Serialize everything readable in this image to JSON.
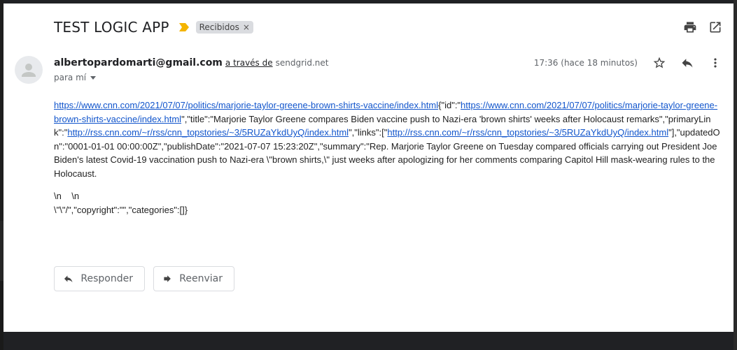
{
  "message": {
    "subject": "TEST LOGIC APP",
    "label": "Recibidos",
    "label_remove": "×",
    "sender_email": "albertopardomarti@gmail.com",
    "via_text": "a través de",
    "via_domain": "sendgrid.net",
    "to_text": "para mí",
    "time": "17:36 (hace 18 minutos)"
  },
  "body": {
    "link1": "https://www.cnn.com/2021/07/07/politics/marjorie-taylor-greene-brown-shirts-vaccine/index.html",
    "t1": "{\"id\":\"",
    "link2": "https://www.cnn.com/2021/07/07/politics/marjorie-taylor-greene-brown-shirts-vaccine/index.html",
    "t2": "\",\"title\":\"Marjorie Taylor Greene compares Biden vaccine push to Nazi-era 'brown shirts' weeks after Holocaust remarks\",\"primaryLink\":\"",
    "link3": "http://rss.cnn.com/~r/rss/cnn_topstories/~3/5RUZaYkdUyQ/index.html",
    "t3": "\",\"links\":[\"",
    "link4": "http://rss.cnn.com/~r/rss/cnn_topstories/~3/5RUZaYkdUyQ/index.html",
    "t4": "\"],\"updatedOn\":\"0001-01-01 00:00:00Z\",\"publishDate\":\"2021-07-07 15:23:20Z\",\"summary\":\"Rep. Marjorie Taylor Greene on Tuesday compared officials carrying out President Joe Biden's latest Covid-19 vaccination push to Nazi-era \\\"brown shirts,\\\" just weeks after apologizing for her comments comparing Capitol Hill mask-wearing rules to the Holocaust.",
    "line2": "\\n    \\n",
    "line3": "\\\"\\\"/\",\"copyright\":\"\",\"categories\":[]}"
  },
  "actions": {
    "reply_label": "Responder",
    "forward_label": "Reenviar"
  },
  "icons": {
    "importance": "importance-marker-icon",
    "print": "print-icon",
    "open_new": "open-in-new-window-icon",
    "star": "star-icon",
    "reply": "reply-icon",
    "more": "more-vert-icon",
    "avatar": "person-icon",
    "dropdown": "caret-down-icon"
  },
  "colors": {
    "link": "#1155cc",
    "importance": "#f4b400",
    "chip_bg": "#dadce0"
  }
}
